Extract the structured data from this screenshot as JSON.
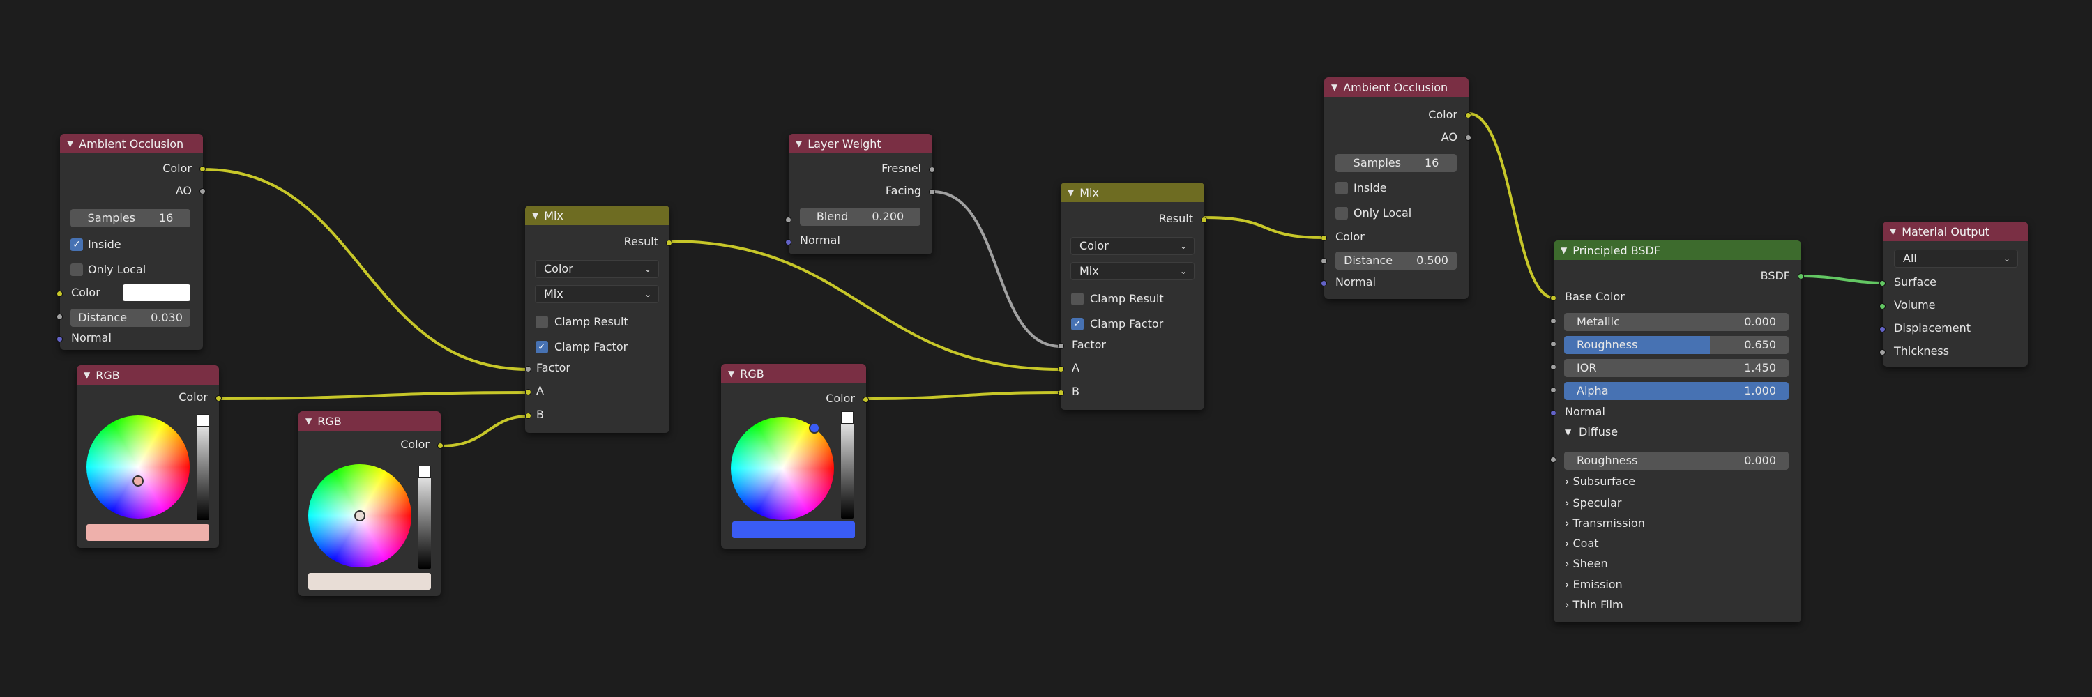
{
  "colors": {
    "color_socket": "#c7c729",
    "float_socket": "#a1a1a1",
    "vector_socket": "#6363c7",
    "shader_socket": "#63c763",
    "input_header": "#7a2f44",
    "mix_header": "#6e6c22",
    "shader_header": "#3d6b2d",
    "value_bar": "#4772b3"
  },
  "icons": {
    "collapse": "chevron-down-icon",
    "expand": "chevron-right-icon",
    "dropdown": "dropdown-arrow-icon",
    "check": "checkmark-icon"
  },
  "ao1": {
    "title": "Ambient Occlusion",
    "out_color": "Color",
    "out_ao": "AO",
    "samples_label": "Samples",
    "samples_value": "16",
    "inside": "Inside",
    "only_local": "Only Local",
    "color": "Color",
    "distance_label": "Distance",
    "distance_value": "0.030",
    "normal": "Normal"
  },
  "rgb1": {
    "title": "RGB",
    "out_color": "Color",
    "swatch": "#eeb0ab"
  },
  "rgb2": {
    "title": "RGB",
    "out_color": "Color",
    "swatch": "#e8ddd6"
  },
  "mix1": {
    "title": "Mix",
    "result": "Result",
    "data_type": "Color",
    "blend": "Mix",
    "clamp_result": "Clamp Result",
    "clamp_factor": "Clamp Factor",
    "factor": "Factor",
    "a": "A",
    "b": "B"
  },
  "lw": {
    "title": "Layer Weight",
    "fresnel": "Fresnel",
    "facing": "Facing",
    "blend_label": "Blend",
    "blend_value": "0.200",
    "normal": "Normal"
  },
  "rgb3": {
    "title": "RGB",
    "out_color": "Color",
    "swatch": "#3a5cf5"
  },
  "mix2": {
    "title": "Mix",
    "result": "Result",
    "data_type": "Color",
    "blend": "Mix",
    "clamp_result": "Clamp Result",
    "clamp_factor": "Clamp Factor",
    "factor": "Factor",
    "a": "A",
    "b": "B"
  },
  "ao2": {
    "title": "Ambient Occlusion",
    "out_color": "Color",
    "out_ao": "AO",
    "samples_label": "Samples",
    "samples_value": "16",
    "inside": "Inside",
    "only_local": "Only Local",
    "color": "Color",
    "distance_label": "Distance",
    "distance_value": "0.500",
    "normal": "Normal"
  },
  "bsdf": {
    "title": "Principled BSDF",
    "out": "BSDF",
    "base_color": "Base Color",
    "metallic_label": "Metallic",
    "metallic_value": "0.000",
    "roughness_label": "Roughness",
    "roughness_value": "0.650",
    "roughness_fraction": 0.65,
    "ior_label": "IOR",
    "ior_value": "1.450",
    "alpha_label": "Alpha",
    "alpha_value": "1.000",
    "normal": "Normal",
    "diffuse": "Diffuse",
    "diffuse_roughness_label": "Roughness",
    "diffuse_roughness_value": "0.000",
    "panels": [
      "Subsurface",
      "Specular",
      "Transmission",
      "Coat",
      "Sheen",
      "Emission",
      "Thin Film"
    ]
  },
  "out": {
    "title": "Material Output",
    "target": "All",
    "surface": "Surface",
    "volume": "Volume",
    "displacement": "Displacement",
    "thickness": "Thickness"
  }
}
